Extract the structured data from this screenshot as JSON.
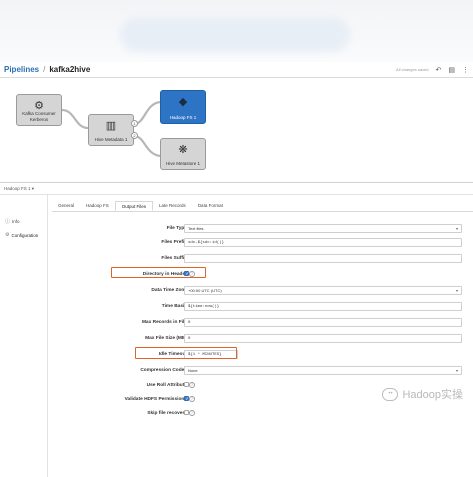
{
  "header": {
    "breadcrumb_root": "Pipelines",
    "separator": "/",
    "pipeline_name": "kafka2hive",
    "status_text": "All changes saved"
  },
  "icons": {
    "undo": "undo-icon",
    "redo": "redo-icon",
    "save": "document-icon",
    "more": "more-vertical-icon"
  },
  "canvas": {
    "stages": [
      {
        "label": "Kafka Consumer\nKerberos",
        "icon": "kafka-icon",
        "selected": false
      },
      {
        "label": "Hive Metadata 1",
        "icon": "database-icon",
        "selected": false
      },
      {
        "label": "Hadoop FS 1",
        "icon": "hadoop-icon",
        "selected": true
      },
      {
        "label": "Hive Metastore 1",
        "icon": "hive-icon",
        "selected": false
      }
    ],
    "ports": [
      "1",
      "2"
    ]
  },
  "panel": {
    "title": "Hadoop FS 1 ▾",
    "side_nav": [
      {
        "label": "Info",
        "icon": "info-icon"
      },
      {
        "label": "Configuration",
        "icon": "gear-icon"
      }
    ],
    "tabs": [
      "General",
      "Hadoop FS",
      "Output Files",
      "Late Records",
      "Data Format"
    ],
    "active_tab": "Output Files"
  },
  "form": {
    "file_type": {
      "label": "File Type",
      "value": "Text files"
    },
    "files_prefix": {
      "label": "Files Prefix",
      "value": "sdc-${sdc:id()}"
    },
    "files_suffix": {
      "label": "Files Suffix",
      "value": ""
    },
    "directory_in_header": {
      "label": "Directory in Header",
      "checked": true
    },
    "data_time_zone": {
      "label": "Data Time Zone",
      "value": "+00:00 UTC (UTC)"
    },
    "time_basis": {
      "label": "Time Basis",
      "value": "${time:now()}"
    },
    "max_records": {
      "label": "Max Records in File",
      "value": "0"
    },
    "max_file_size": {
      "label": "Max File Size (MB)",
      "value": "0"
    },
    "idle_timeout": {
      "label": "Idle Timeout",
      "value": "${1 * MINUTES}"
    },
    "compression_codec": {
      "label": "Compression Codec",
      "value": "None"
    },
    "use_roll_attribute": {
      "label": "Use Roll Attribute",
      "checked": false
    },
    "validate_permissions": {
      "label": "Validate HDFS Permissions",
      "checked": true
    },
    "skip_file_recovery": {
      "label": "Skip file recovery",
      "checked": false
    }
  },
  "watermark": {
    "text": "Hadoop实操"
  },
  "colors": {
    "accent": "#2a6fb6",
    "selected_stage": "#2d74c5",
    "highlight_box": "#e0642a"
  }
}
